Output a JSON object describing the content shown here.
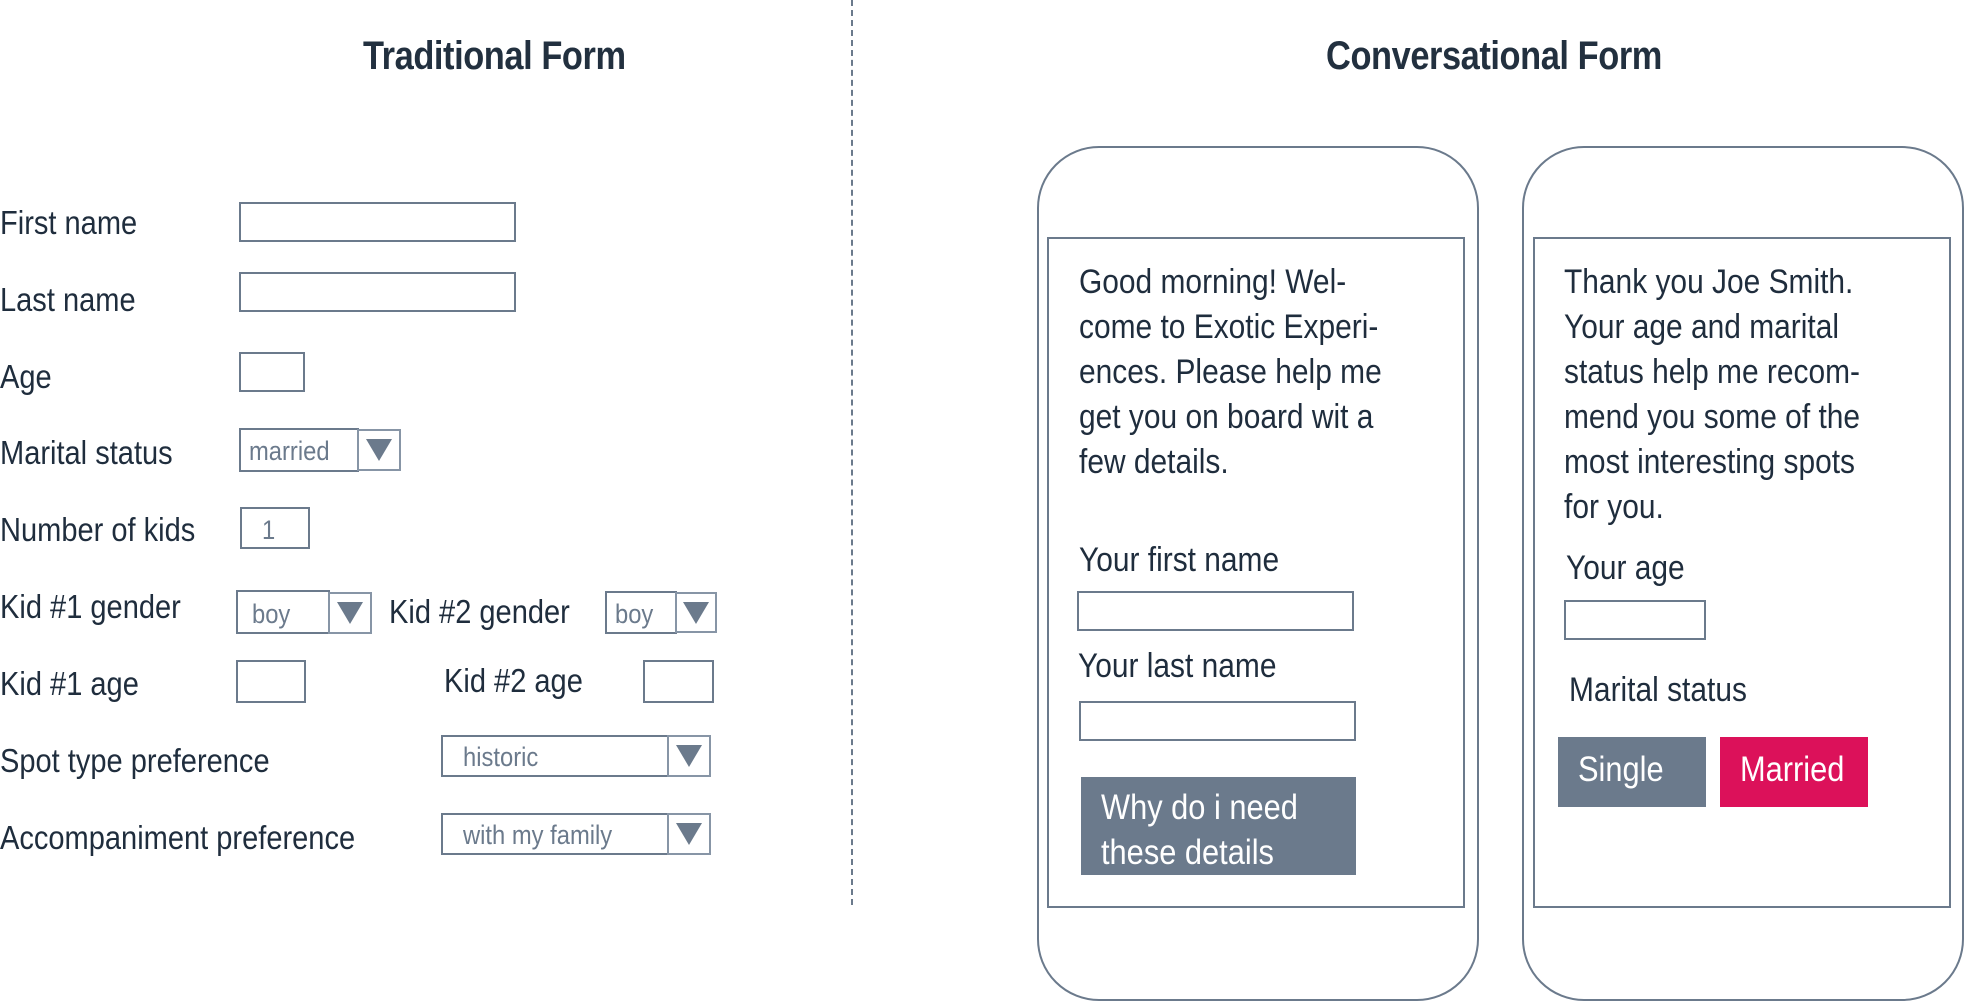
{
  "traditional": {
    "title": "Traditional Form",
    "fields": {
      "first_name": {
        "label": "First name",
        "value": ""
      },
      "last_name": {
        "label": "Last name",
        "value": ""
      },
      "age": {
        "label": "Age",
        "value": ""
      },
      "marital_status": {
        "label": "Marital status",
        "selected": "married"
      },
      "number_of_kids": {
        "label": "Number of kids",
        "value": "1"
      },
      "kid1_gender": {
        "label": "Kid #1 gender",
        "selected": "boy"
      },
      "kid2_gender": {
        "label": "Kid #2 gender",
        "selected": "boy"
      },
      "kid1_age": {
        "label": "Kid #1 age",
        "value": ""
      },
      "kid2_age": {
        "label": "Kid #2 age",
        "value": ""
      },
      "spot_type": {
        "label": "Spot type preference",
        "selected": "historic"
      },
      "accompaniment": {
        "label": "Accompaniment preference",
        "selected": "with my family"
      }
    }
  },
  "conversational": {
    "title": "Conversational Form",
    "phone1": {
      "message": "Good morning! Wel-\ncome to Exotic Experi-\nences. Please help me\nget you on board wit a\nfew details.",
      "first_name_label": "Your first name",
      "first_name_value": "",
      "last_name_label": "Your last name",
      "last_name_value": "",
      "why_button": "Why do i need\nthese details"
    },
    "phone2": {
      "message": "Thank you Joe Smith.\nYour age and marital\nstatus help me recom-\nmend you some of the\nmost interesting spots\nfor you.",
      "age_label": "Your age",
      "age_value": "",
      "marital_label": "Marital status",
      "options": [
        "Single",
        "Married"
      ],
      "selected": "Married"
    }
  },
  "colors": {
    "text": "#1f2d3d",
    "outline": "#6b7a8c",
    "button_gray": "#6b7a8c",
    "accent_pink": "#dc115a"
  }
}
